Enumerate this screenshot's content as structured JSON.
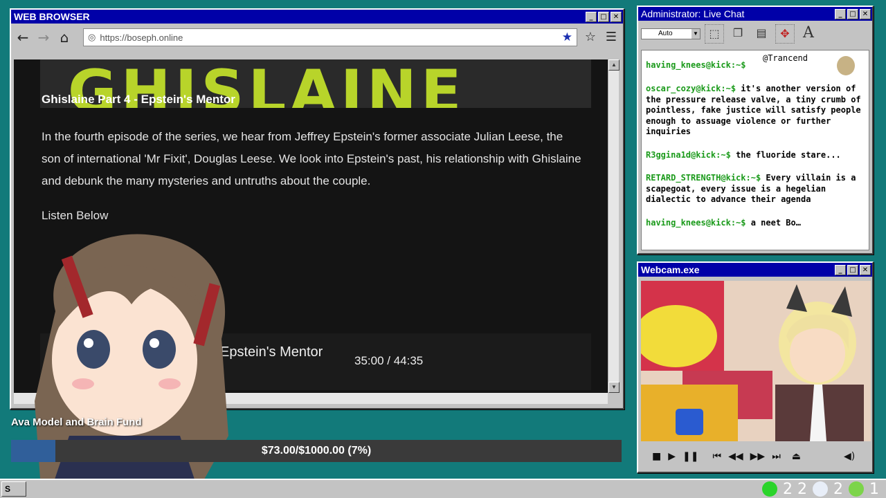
{
  "browser": {
    "title": "WEB BROWSER",
    "url": "https://boseph.online",
    "banner_word": "GHISLAINE",
    "episode_title": "Ghislaine Part 4 - Epstein's Mentor",
    "description": "In the fourth episode of the series, we hear from Jeffrey Epstein's former associate Julian Leese, the son of international 'Mr Fixit', Douglas Leese. We look into Epstein's past, his relationship with Ghislaine and debunk the many mysteries and untruths about the couple.",
    "listen_label": "Listen Below",
    "player_title": "Epstein's Mentor",
    "player_time": "35:00  /  44:35"
  },
  "chat": {
    "title": "Administrator: Live Chat",
    "select_value": "Auto",
    "top_user": "@Trancend",
    "messages": [
      {
        "user": "having_knees@kick:~$",
        "text": ""
      },
      {
        "user": "oscar_cozy@kick:~$",
        "text": "it's another version of the pressure release valve, a tiny crumb of pointless, fake justice will satisfy people enough to assuage violence or further inquiries"
      },
      {
        "user": "R3ggina1d@kick:~$",
        "text": "the fluoride stare..."
      },
      {
        "user": "RETARD_STRENGTH@kick:~$",
        "text": "Every villain is a scapegoat, every issue is a hegelian dialectic to advance their agenda"
      },
      {
        "user": "having_knees@kick:~$",
        "text": "a neet Bo…"
      }
    ]
  },
  "webcam": {
    "title": "Webcam.exe"
  },
  "fund": {
    "title": "Ava Model and Brain Fund",
    "text": "$73.00/$1000.00 (7%)",
    "fraction": 0.073
  },
  "taskbar": {
    "start_label": "S",
    "tray_count_1": "2 2",
    "tray_count_2": "2",
    "tray_count_3": "1"
  },
  "colors": {
    "desktop": "#127a7a",
    "titlebar": "#0000a8",
    "accent_green": "#b8d42a",
    "fund_fill": "#305f9a"
  }
}
